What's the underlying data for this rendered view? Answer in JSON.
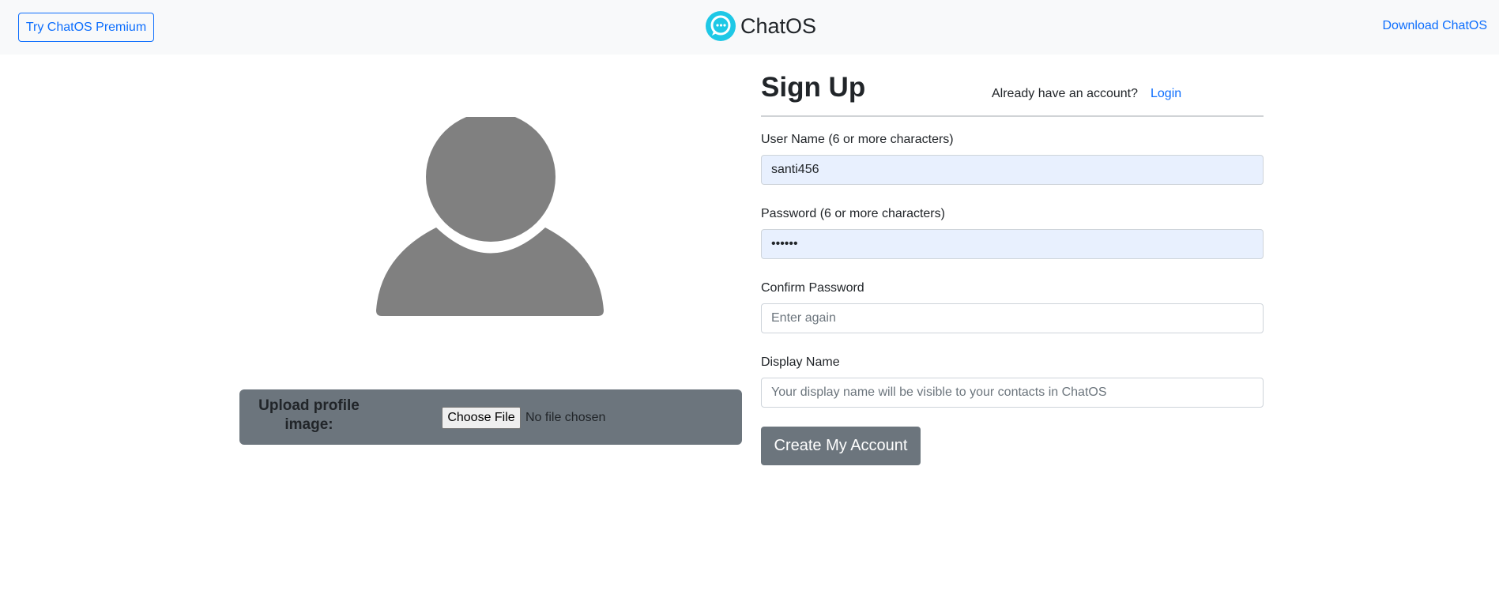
{
  "header": {
    "premium_button": "Try ChatOS Premium",
    "brand_name": "ChatOS",
    "brand_icon": "chat-bubble-logo-icon",
    "download_link": "Download ChatOS"
  },
  "avatar": {
    "icon": "user-silhouette-icon"
  },
  "upload": {
    "label": "Upload profile image:",
    "choose_button": "Choose File",
    "status": "No file chosen"
  },
  "form": {
    "title": "Sign Up",
    "have_account": "Already have an account?",
    "login_link": "Login",
    "username_label": "User Name (6 or more characters)",
    "username_value": "santi456",
    "password_label": "Password (6 or more characters)",
    "password_value": "santi4",
    "confirm_label": "Confirm Password",
    "confirm_placeholder": "Enter again",
    "display_label": "Display Name",
    "display_placeholder": "Your display name will be visible to your contacts in ChatOS",
    "submit_button": "Create My Account"
  },
  "colors": {
    "primary": "#0d6efd",
    "secondary": "#6c757d",
    "autofill_bg": "#e8f0fe",
    "logo_cyan": "#1ec8e6"
  }
}
